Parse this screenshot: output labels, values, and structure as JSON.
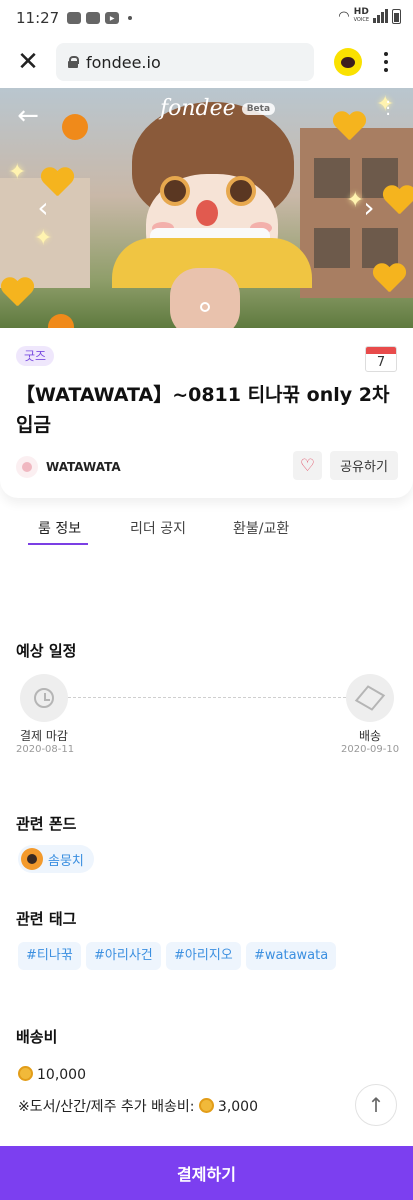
{
  "status_bar": {
    "time": "11:27",
    "network": "HD"
  },
  "browser": {
    "url": "fondee.io"
  },
  "hero": {
    "logo": "fondee",
    "beta": "Beta"
  },
  "product": {
    "category": "굿즈",
    "calendar_day": "7",
    "title": "【WATAWATA】~0811 티나꾺 only 2차입금",
    "leader": "WATAWATA",
    "share_label": "공유하기"
  },
  "tabs": [
    "룸 정보",
    "리더 공지",
    "환불/교환"
  ],
  "schedule": {
    "title": "예상 일정",
    "start_label": "결제 마감",
    "start_date": "2020-08-11",
    "end_label": "배송",
    "end_date": "2020-09-10"
  },
  "related_fond": {
    "title": "관련 폰드",
    "name": "솜뭉치"
  },
  "related_tags": {
    "title": "관련 태그",
    "tags": [
      "#티나꾺",
      "#아리사건",
      "#아리지오",
      "#watawata"
    ]
  },
  "shipping": {
    "title": "배송비",
    "fee": "10,000",
    "extra_label": "※도서/산간/제주 추가 배송비:",
    "extra_fee": "3,000"
  },
  "pay_button": "결제하기",
  "colors": {
    "accent": "#7c3ff0",
    "tag_text": "#3b8fe0",
    "kakao": "#fae100"
  }
}
